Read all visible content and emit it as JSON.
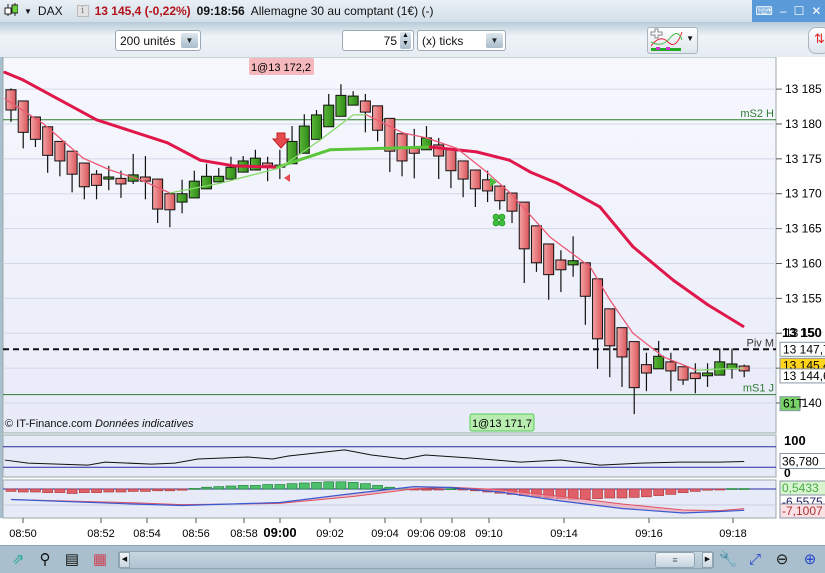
{
  "titlebar": {
    "symbol": "DAX",
    "price_change": "13 145,4 (-0,22%)",
    "time": "09:18:56",
    "instrument": "Allemagne 30 au comptant (1€) (-)",
    "info_icon": "i"
  },
  "toolbar": {
    "size_select": "200 unités",
    "tick_count": "75",
    "period_select": "(x) ticks"
  },
  "colors": {
    "candle_up": "#3a9a1c",
    "candle_down": "#e87a7c",
    "ma_long_down": "#e0174a",
    "ma_long_up": "#5cc63a",
    "ma_short_down": "#ec5a74",
    "ma_short_up": "#86d86a",
    "level_line": "#2e7d32",
    "price_tag_current": "#ffd31a",
    "volume_tag": "#7ad36a",
    "order_sell": "#f5b8bc",
    "order_buy": "#b9ecb0"
  },
  "chart_data": {
    "type": "candlestick",
    "ylim": [
      13135.7,
      13189.6
    ],
    "y_tick_values": [
      13185,
      13180,
      13175,
      13170,
      13165,
      13160,
      13155,
      13150,
      13145,
      13140
    ],
    "y_ticks": [
      "13 185",
      "13 180",
      "13 175",
      "13 170",
      "13 165",
      "13 160",
      "13 155",
      "13 150",
      "",
      "13 140"
    ],
    "candles": [
      [
        13184.9,
        13185.1,
        13180.3,
        13182.0
      ],
      [
        13183.3,
        13183.3,
        13176.5,
        13178.8
      ],
      [
        13181.0,
        13181.0,
        13176.7,
        13177.8
      ],
      [
        13179.6,
        13179.6,
        13173.0,
        13175.5
      ],
      [
        13177.5,
        13177.5,
        13172.5,
        13174.7
      ],
      [
        13176.1,
        13176.1,
        13170.2,
        13172.8
      ],
      [
        13174.4,
        13174.4,
        13169.2,
        13171.0
      ],
      [
        13172.8,
        13173.4,
        13169.2,
        13171.2
      ],
      [
        13172.1,
        13174.0,
        13170.5,
        13172.4
      ],
      [
        13172.2,
        13173.3,
        13169.4,
        13171.4
      ],
      [
        13171.8,
        13175.7,
        13171.4,
        13172.7
      ],
      [
        13172.4,
        13175.4,
        13169.2,
        13171.8
      ],
      [
        13172.1,
        13172.1,
        13165.8,
        13167.8
      ],
      [
        13170.0,
        13170.0,
        13165.2,
        13167.7
      ],
      [
        13168.8,
        13172.0,
        13167.2,
        13170.0
      ],
      [
        13169.4,
        13173.3,
        13169.4,
        13171.8
      ],
      [
        13170.7,
        13174.3,
        13170.7,
        13172.5
      ],
      [
        13171.7,
        13173.7,
        13171.7,
        13172.5
      ],
      [
        13172.1,
        13175.3,
        13172.1,
        13173.8
      ],
      [
        13173.1,
        13175.4,
        13173.1,
        13174.7
      ],
      [
        13173.4,
        13176.3,
        13173.4,
        13175.1
      ],
      [
        13174.4,
        13175.3,
        13171.8,
        13174.0
      ],
      [
        13174.0,
        13176.3,
        13172.1,
        13174.1
      ],
      [
        13174.3,
        13179.7,
        13174.3,
        13177.5
      ],
      [
        13175.8,
        13181.4,
        13175.8,
        13179.7
      ],
      [
        13177.8,
        13182.0,
        13177.8,
        13181.3
      ],
      [
        13179.6,
        13184.3,
        13179.6,
        13182.7
      ],
      [
        13181.1,
        13185.7,
        13181.1,
        13184.1
      ],
      [
        13182.7,
        13184.7,
        13182.7,
        13184.0
      ],
      [
        13183.3,
        13184.3,
        13178.8,
        13181.7
      ],
      [
        13182.6,
        13182.6,
        13177.5,
        13179.1
      ],
      [
        13180.8,
        13180.8,
        13173.1,
        13176.1
      ],
      [
        13178.6,
        13178.6,
        13172.5,
        13174.7
      ],
      [
        13176.5,
        13179.3,
        13172.2,
        13175.8
      ],
      [
        13176.3,
        13179.7,
        13176.3,
        13178.0
      ],
      [
        13177.0,
        13178.0,
        13172.1,
        13175.4
      ],
      [
        13176.3,
        13176.3,
        13170.8,
        13173.3
      ],
      [
        13174.7,
        13174.7,
        13169.5,
        13172.1
      ],
      [
        13173.4,
        13173.4,
        13168.1,
        13170.7
      ],
      [
        13172.0,
        13173.3,
        13168.8,
        13170.4
      ],
      [
        13171.1,
        13171.1,
        13167.7,
        13169.0
      ],
      [
        13170.1,
        13170.1,
        13165.8,
        13167.5
      ],
      [
        13168.8,
        13168.8,
        13157.2,
        13162.1
      ],
      [
        13165.4,
        13165.4,
        13158.8,
        13160.1
      ],
      [
        13162.8,
        13162.8,
        13154.8,
        13158.4
      ],
      [
        13160.5,
        13161.9,
        13155.9,
        13159.1
      ],
      [
        13159.8,
        13163.9,
        13158.1,
        13160.4
      ],
      [
        13160.1,
        13160.1,
        13151.2,
        13155.3
      ],
      [
        13157.8,
        13157.8,
        13144.9,
        13149.2
      ],
      [
        13153.5,
        13153.5,
        13143.7,
        13148.2
      ],
      [
        13150.8,
        13150.8,
        13142.3,
        13146.6
      ],
      [
        13148.8,
        13148.8,
        13138.4,
        13142.2
      ],
      [
        13145.5,
        13147.2,
        13141.7,
        13144.3
      ],
      [
        13144.9,
        13148.9,
        13144.9,
        13146.7
      ],
      [
        13145.9,
        13147.2,
        13141.7,
        13144.6
      ],
      [
        13145.2,
        13145.2,
        13142.6,
        13143.3
      ],
      [
        13144.3,
        13145.7,
        13141.4,
        13143.5
      ],
      [
        13143.9,
        13145.7,
        13142.3,
        13144.3
      ],
      [
        13144.0,
        13147.8,
        13144.0,
        13145.9
      ],
      [
        13144.9,
        13147.8,
        13143.5,
        13145.6
      ],
      [
        13145.3,
        13145.5,
        13143.7,
        13144.6
      ]
    ],
    "ma_long": [
      [
        -0.5,
        13187.4
      ],
      [
        1,
        13186.3
      ],
      [
        7,
        13180.6
      ],
      [
        12.8,
        13177.3
      ],
      [
        15.5,
        13174.8
      ],
      [
        18.2,
        13174.0
      ],
      [
        21.8,
        13173.8
      ],
      [
        26.1,
        13176.3
      ],
      [
        30.2,
        13176.5
      ],
      [
        34.3,
        13176.7
      ],
      [
        38.1,
        13176.0
      ],
      [
        40.8,
        13174.8
      ],
      [
        42.5,
        13173.1
      ],
      [
        44.7,
        13171.5
      ],
      [
        48.2,
        13168.1
      ],
      [
        50.9,
        13162.4
      ],
      [
        54.2,
        13157.6
      ],
      [
        57.0,
        13154.1
      ],
      [
        59.9,
        13151.0
      ]
    ],
    "ma_short": [
      [
        -0.5,
        13183.6
      ],
      [
        2.6,
        13180.1
      ],
      [
        5.9,
        13175.1
      ],
      [
        8.1,
        13173.4
      ],
      [
        10.6,
        13172.0
      ],
      [
        13.0,
        13170.1
      ],
      [
        17.1,
        13171.5
      ],
      [
        22.0,
        13173.7
      ],
      [
        25.3,
        13177.7
      ],
      [
        28.0,
        13181.3
      ],
      [
        29.1,
        13181.3
      ],
      [
        32.1,
        13178.7
      ],
      [
        34.0,
        13178.0
      ],
      [
        36.5,
        13176.5
      ],
      [
        39.0,
        13173.0
      ],
      [
        40.8,
        13170.2
      ],
      [
        44.1,
        13163.8
      ],
      [
        47.4,
        13159.5
      ],
      [
        49.0,
        13154.8
      ],
      [
        50.9,
        13150.0
      ],
      [
        53.4,
        13146.6
      ],
      [
        56.1,
        13144.7
      ],
      [
        58.3,
        13144.9
      ],
      [
        59.9,
        13145.0
      ]
    ],
    "levels": [
      {
        "label": "mS2 H",
        "value": 13180.6,
        "style": "solid"
      },
      {
        "label": "Piv M",
        "value": 13147.7,
        "style": "dashed"
      },
      {
        "label": "mS1 J",
        "value": 13141.2,
        "style": "solid"
      }
    ],
    "bold_tick": {
      "text": "13 150",
      "value": 13150
    },
    "price_tags": [
      {
        "text": "13 147,7",
        "value": 13147.7
      },
      {
        "text": "13 145,4",
        "value": 13145.4
      },
      {
        "text": "13 144,6",
        "value": 13144.6
      },
      {
        "text": "61T",
        "value": 13142.2
      }
    ],
    "orders": [
      {
        "text": "1@13 172,2",
        "side": "sell"
      },
      {
        "text": "1@13 171,7",
        "side": "buy"
      }
    ],
    "x_ticks": [
      "08:50",
      "08:52",
      "08:54",
      "08:56",
      "08:58",
      "09:00",
      "09:02",
      "09:04",
      "09:06",
      "09:08",
      "09:10",
      "09:14",
      "09:16",
      "09:18"
    ],
    "x_tick_bold": "09:00",
    "indicator1": {
      "axis_top": "100",
      "axis_bottom": "0",
      "value_tag": "36,780",
      "bands": [
        80,
        20
      ],
      "values": [
        [
          -0.5,
          41
        ],
        [
          1.4,
          32
        ],
        [
          6.3,
          26
        ],
        [
          7.7,
          35
        ],
        [
          11.5,
          29
        ],
        [
          13.4,
          32
        ],
        [
          15.3,
          44
        ],
        [
          19.4,
          50
        ],
        [
          21.4,
          44
        ],
        [
          22.7,
          53
        ],
        [
          27.3,
          71
        ],
        [
          29.5,
          56
        ],
        [
          32.2,
          44
        ],
        [
          33.9,
          56
        ],
        [
          37.6,
          47
        ],
        [
          41.7,
          35
        ],
        [
          45.0,
          41
        ],
        [
          48.2,
          26
        ],
        [
          51.5,
          32
        ],
        [
          54.7,
          35
        ],
        [
          58.0,
          35
        ],
        [
          60.0,
          36.78
        ]
      ]
    },
    "indicator2": {
      "tag_top": "0,5433",
      "tag_mid": "-6,5575",
      "tag_bottom": "-7,1007",
      "histogram": [
        -0.8,
        -1,
        -1,
        -1.2,
        -1.2,
        -1.5,
        -1.2,
        -1.2,
        -1,
        -1,
        -0.8,
        -0.8,
        -0.6,
        -0.6,
        -0.4,
        0.2,
        0.6,
        0.8,
        1,
        1.2,
        1.2,
        1.5,
        1.5,
        1.8,
        2,
        2.2,
        2.4,
        2.4,
        2.2,
        1.8,
        1.2,
        0.6,
        0.2,
        -0.2,
        -0.4,
        -0.2,
        0.1,
        -0.3,
        -0.6,
        -1,
        -1.4,
        -1.8,
        -2.2,
        -2.6,
        -3,
        -3.2,
        -3.4,
        -3.4,
        -3.2,
        -3,
        -3,
        -2.8,
        -2.6,
        -2.2,
        -1.8,
        -1.2,
        -0.8,
        -0.4,
        -0.2,
        0.15,
        0.15
      ],
      "macd": [
        [
          0,
          -3.5
        ],
        [
          10,
          -5
        ],
        [
          14,
          -5.5
        ],
        [
          22,
          -4.5
        ],
        [
          28,
          -1.5
        ],
        [
          33,
          0.8
        ],
        [
          36,
          0.5
        ],
        [
          40,
          -1
        ],
        [
          45,
          -4
        ],
        [
          50,
          -6.5
        ],
        [
          55,
          -8
        ],
        [
          58,
          -7.5
        ],
        [
          60,
          -7.1
        ]
      ],
      "signal": [
        [
          0,
          -3.5
        ],
        [
          10,
          -4.6
        ],
        [
          14,
          -5.2
        ],
        [
          22,
          -4.8
        ],
        [
          28,
          -2.5
        ],
        [
          33,
          0.1
        ],
        [
          36,
          0.6
        ],
        [
          40,
          -0.2
        ],
        [
          45,
          -2.5
        ],
        [
          50,
          -5
        ],
        [
          55,
          -7
        ],
        [
          58,
          -7.2
        ],
        [
          60,
          -6.56
        ]
      ]
    }
  },
  "footer": {
    "copyright": "© IT-Finance.com",
    "note": "Données indicatives"
  }
}
